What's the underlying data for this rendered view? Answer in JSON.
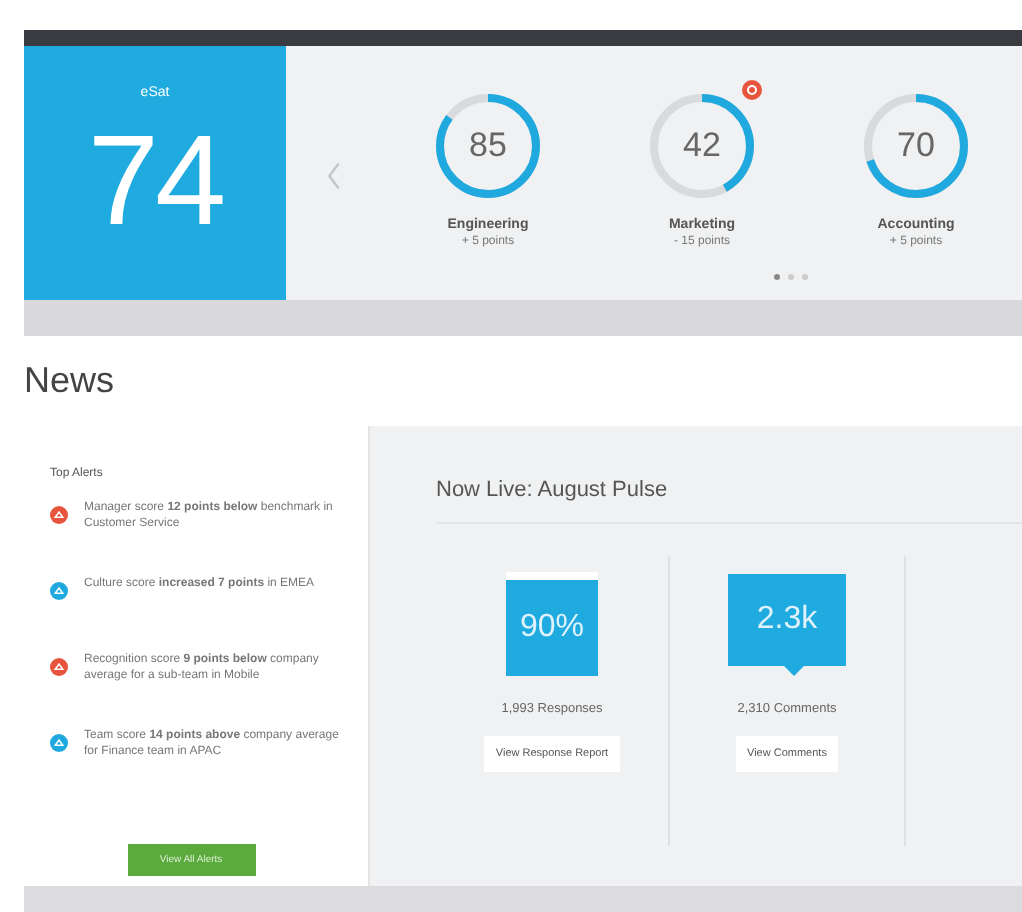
{
  "score_card": {
    "label": "eSat",
    "value": "74"
  },
  "departments": [
    {
      "name": "Engineering",
      "change": "+ 5 points",
      "score": "85",
      "level": 0.85,
      "alert": false
    },
    {
      "name": "Marketing",
      "change": "- 15 points",
      "score": "42",
      "level": 0.42,
      "alert": true
    },
    {
      "name": "Accounting",
      "change": "+ 5 points",
      "score": "70",
      "level": 0.7,
      "alert": false
    }
  ],
  "pager": [
    {
      "selected": true
    },
    {
      "selected": false
    },
    {
      "selected": false
    }
  ],
  "news": {
    "title": "News"
  },
  "top_alerts": {
    "title": "Top Alerts",
    "items": [
      {
        "text": "Manager score **12 points below** benchmark in Customer Service",
        "color": "#e8553e"
      },
      {
        "text": "Culture score **increased 7 points** in EMEA",
        "color": "#1fa9df"
      },
      {
        "text": "Recognition score **9 points below** company average for a sub-team in Mobile",
        "color": "#e8553e"
      },
      {
        "text": "Team score **14 points above** company average for Finance team in APAC",
        "color": "#1fa9df"
      }
    ],
    "button": "View All Alerts"
  },
  "pulse": {
    "title": "Now Live: August Pulse",
    "stats": [
      {
        "kind": "response",
        "value": "90%",
        "caption": "1,993 Responses",
        "button": "View Response Report"
      },
      {
        "kind": "comment",
        "value": "2.3k",
        "caption": "2,310 Comments",
        "button": "View Comments"
      }
    ]
  }
}
